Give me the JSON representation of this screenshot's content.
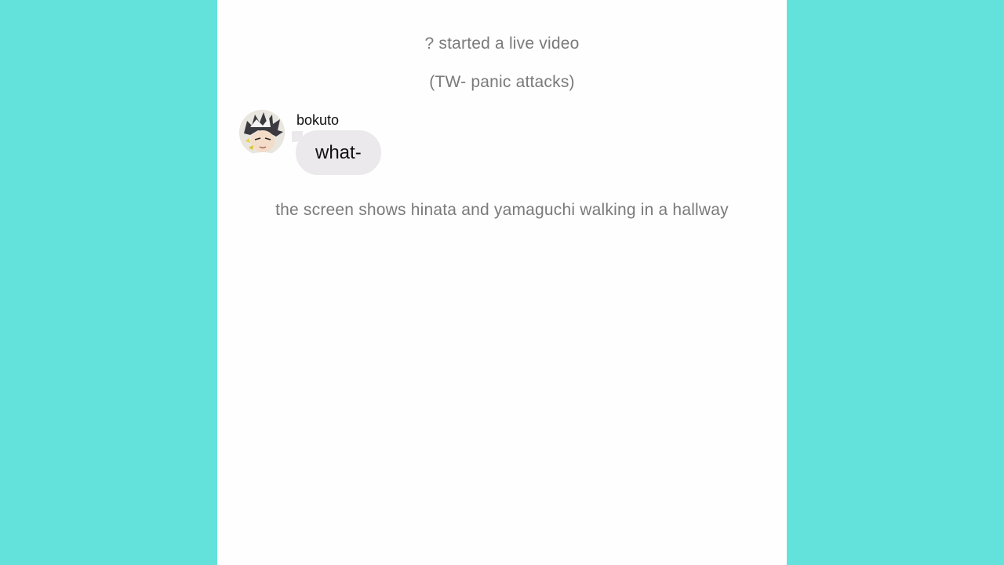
{
  "colors": {
    "background": "#63e2dc",
    "screen": "#fefefe",
    "system_text": "#7a7a7a",
    "bubble": "#ebe9ec"
  },
  "chat": {
    "system_messages": [
      "? started a live video",
      "(TW- panic attacks)",
      "the screen shows hinata and yamaguchi walking in a hallway"
    ],
    "message": {
      "sender": "bokuto",
      "text": "what-",
      "avatar_icon": "avatar-icon"
    }
  }
}
